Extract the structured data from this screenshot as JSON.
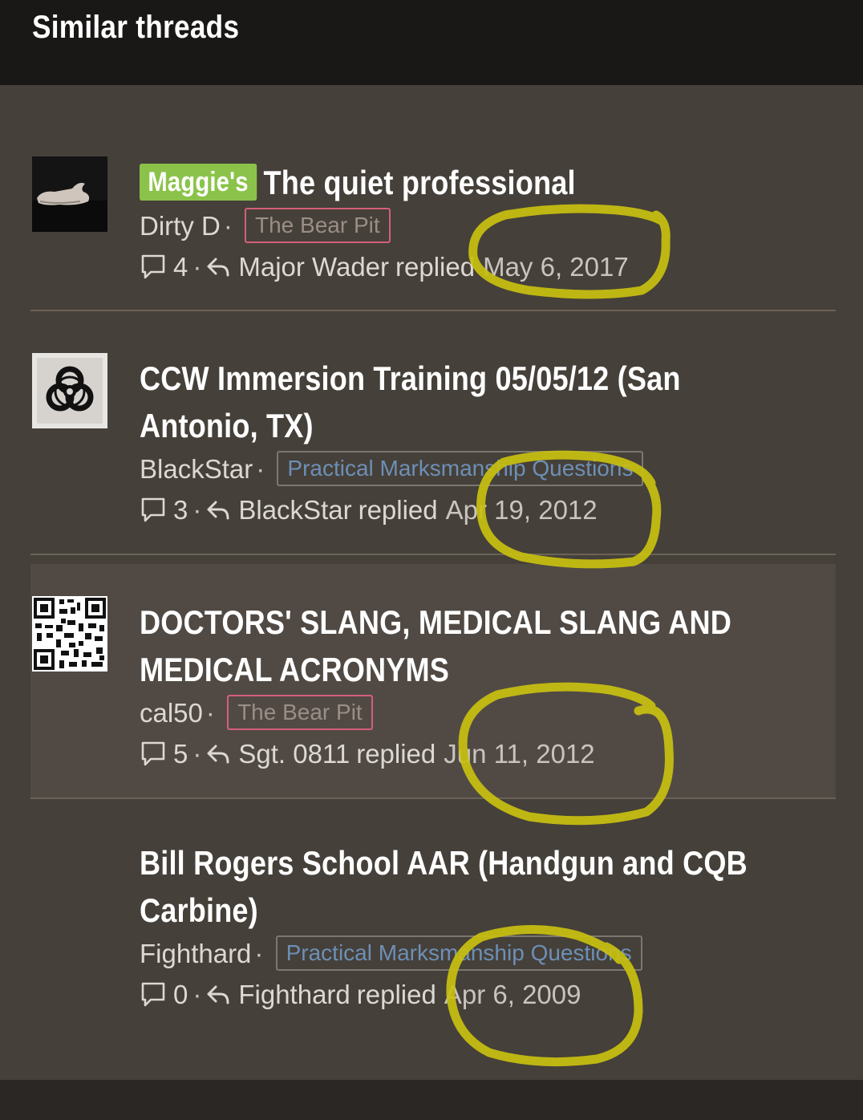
{
  "header": {
    "title": "Similar threads"
  },
  "threads": [
    {
      "prefix": "Maggie's",
      "title": "The quiet professional",
      "author": "Dirty D",
      "forum": "The Bear Pit",
      "reply_count": "4",
      "last_replier": "Major Wader",
      "replied_label": "replied",
      "date": "May 6, 2017"
    },
    {
      "title_line1": "CCW Immersion Training 05/05/12 (San",
      "title_line2": "Antonio, TX)",
      "author": "BlackStar",
      "forum": "Practical Marksmanship Questions",
      "reply_count": "3",
      "last_replier": "BlackStar",
      "replied_label": "replied",
      "date": "Apr 19, 2012"
    },
    {
      "title_line1": "DOCTORS' SLANG, MEDICAL SLANG AND",
      "title_line2": "MEDICAL ACRONYMS",
      "author": "cal50",
      "forum": "The Bear Pit",
      "reply_count": "5",
      "last_replier": "Sgt. 0811",
      "replied_label": "replied",
      "date": "Jun 11, 2012"
    },
    {
      "title_line1": "Bill Rogers School AAR (Handgun and CQB",
      "title_line2": "Carbine)",
      "author": "Fighthard",
      "forum": "Practical Marksmanship Questions",
      "reply_count": "0",
      "last_replier": "Fighthard",
      "replied_label": "replied",
      "date": "Apr 6, 2009"
    }
  ],
  "colors": {
    "background": "#454039",
    "header": "#1a1816",
    "prefix_green": "#8bc34a",
    "annotation": "#c9c010",
    "forum_blue": "#6d8fb6",
    "tag_border_red": "#d45f7a"
  },
  "icons": [
    "comment-icon",
    "reply-icon",
    "biohazard-icon",
    "qr-code-icon"
  ]
}
